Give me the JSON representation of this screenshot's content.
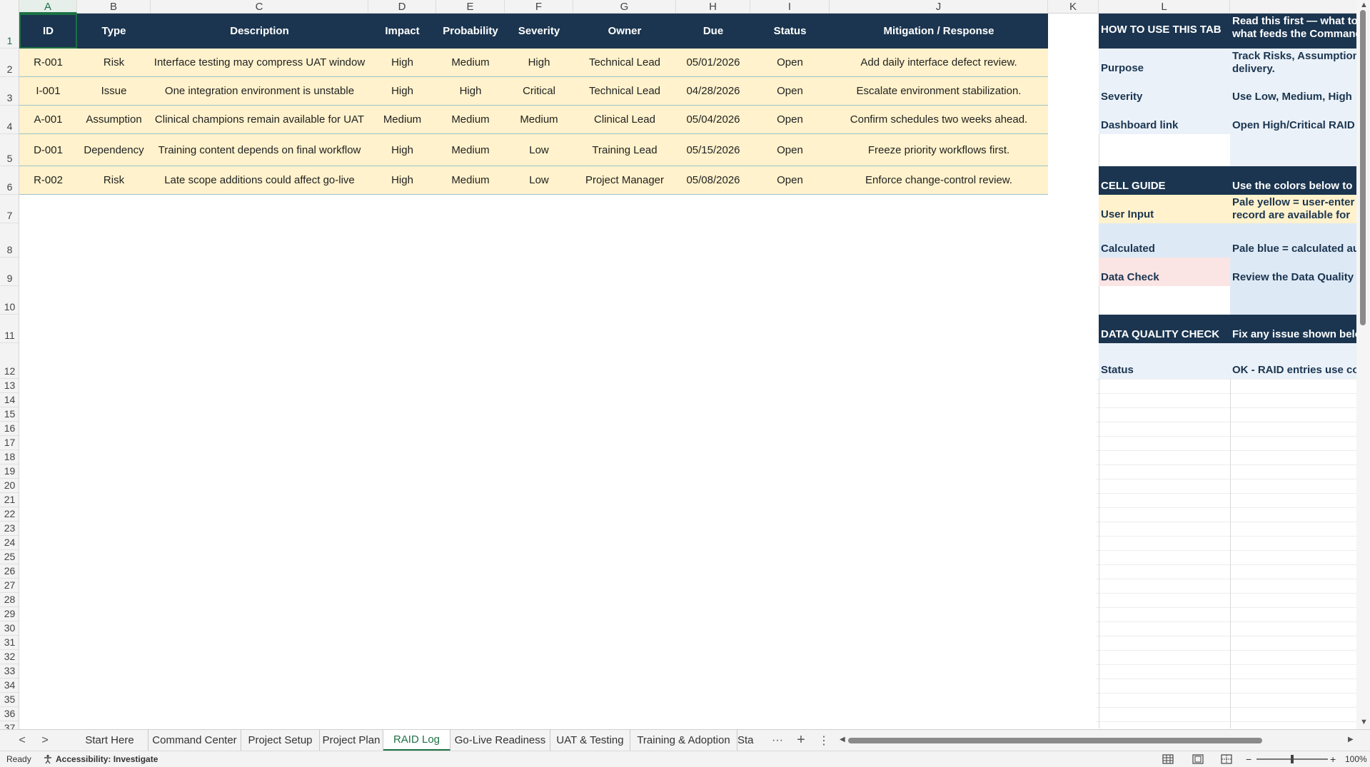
{
  "columns": [
    "A",
    "B",
    "C",
    "D",
    "E",
    "F",
    "G",
    "H",
    "I",
    "J",
    "K",
    "L"
  ],
  "rows": [
    "1",
    "2",
    "3",
    "4",
    "5",
    "6",
    "7",
    "8",
    "9",
    "10",
    "11",
    "12",
    "13",
    "14",
    "15",
    "16",
    "17",
    "18",
    "19",
    "20",
    "21",
    "22",
    "23",
    "24",
    "25",
    "26",
    "27",
    "28",
    "29",
    "30",
    "31",
    "32",
    "33",
    "34",
    "35",
    "36",
    "37"
  ],
  "table": {
    "headers": [
      "ID",
      "Type",
      "Description",
      "Impact",
      "Probability",
      "Severity",
      "Owner",
      "Due",
      "Status",
      "Mitigation / Response"
    ],
    "rows": [
      [
        "R-001",
        "Risk",
        "Interface testing may compress UAT window",
        "High",
        "Medium",
        "High",
        "Technical Lead",
        "05/01/2026",
        "Open",
        "Add daily interface defect review."
      ],
      [
        "I-001",
        "Issue",
        "One integration environment is unstable",
        "High",
        "High",
        "Critical",
        "Technical Lead",
        "04/28/2026",
        "Open",
        "Escalate environment stabilization."
      ],
      [
        "A-001",
        "Assumption",
        "Clinical champions remain available for UAT",
        "Medium",
        "Medium",
        "Medium",
        "Clinical Lead",
        "05/04/2026",
        "Open",
        "Confirm schedules two weeks ahead."
      ],
      [
        "D-001",
        "Dependency",
        "Training content depends on final workflow",
        "High",
        "Medium",
        "Low",
        "Training Lead",
        "05/15/2026",
        "Open",
        "Freeze priority workflows first."
      ],
      [
        "R-002",
        "Risk",
        "Late scope additions could affect go-live",
        "High",
        "Medium",
        "Low",
        "Project Manager",
        "05/08/2026",
        "Open",
        "Enforce change-control review."
      ]
    ]
  },
  "side_panel": {
    "how_to_title": "HOW TO USE THIS TAB",
    "how_to_text": "Read this first — what to what feeds the Command",
    "purpose_label": "Purpose",
    "purpose_text": "Track Risks, Assumption delivery.",
    "severity_label": "Severity",
    "severity_text": "Use Low, Medium, High",
    "dashboard_label": "Dashboard link",
    "dashboard_text": "Open High/Critical RAID",
    "cell_guide_title": "CELL GUIDE",
    "cell_guide_text": "Use the colors below to",
    "user_input_label": "User Input",
    "user_input_text": "Pale yellow = user-enter record are available for",
    "calculated_label": "Calculated",
    "calculated_text": "Pale blue = calculated au",
    "data_check_label": "Data Check",
    "data_check_text": "Review the Data Quality",
    "dq_title": "DATA QUALITY CHECK",
    "dq_text": "Fix any issue shown belo",
    "status_label": "Status",
    "status_text": "OK - RAID entries use co"
  },
  "tabs": [
    "Start Here",
    "Command Center",
    "Project Setup",
    "Project Plan",
    "RAID Log",
    "Go-Live Readiness",
    "UAT & Testing",
    "Training & Adoption",
    "Sta"
  ],
  "active_tab": "RAID Log",
  "tab_controls": {
    "prev": "<",
    "next": ">",
    "more": "···",
    "add": "+",
    "menu": "⋮"
  },
  "status": {
    "ready": "Ready",
    "accessibility": "Accessibility: Investigate",
    "zoom_out": "−",
    "zoom_in": "+",
    "zoom": "100%"
  },
  "colors": {
    "header_navy": "#1b3550",
    "input_yellow": "#fff2cc",
    "calc_blue": "#dde9f5",
    "check_pink": "#fbe4e4",
    "excel_green": "#1e7145"
  },
  "icons": [
    "accessibility-icon",
    "normal-view-icon",
    "page-layout-icon",
    "page-break-icon",
    "zoom-slider"
  ]
}
